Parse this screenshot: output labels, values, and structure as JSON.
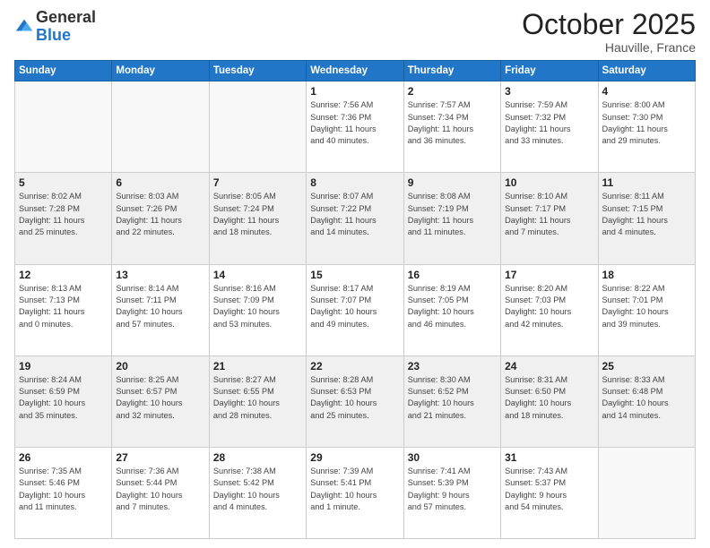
{
  "header": {
    "logo_general": "General",
    "logo_blue": "Blue",
    "month": "October 2025",
    "location": "Hauville, France"
  },
  "days_of_week": [
    "Sunday",
    "Monday",
    "Tuesday",
    "Wednesday",
    "Thursday",
    "Friday",
    "Saturday"
  ],
  "weeks": [
    {
      "shaded": false,
      "days": [
        {
          "num": "",
          "info": ""
        },
        {
          "num": "",
          "info": ""
        },
        {
          "num": "",
          "info": ""
        },
        {
          "num": "1",
          "info": "Sunrise: 7:56 AM\nSunset: 7:36 PM\nDaylight: 11 hours\nand 40 minutes."
        },
        {
          "num": "2",
          "info": "Sunrise: 7:57 AM\nSunset: 7:34 PM\nDaylight: 11 hours\nand 36 minutes."
        },
        {
          "num": "3",
          "info": "Sunrise: 7:59 AM\nSunset: 7:32 PM\nDaylight: 11 hours\nand 33 minutes."
        },
        {
          "num": "4",
          "info": "Sunrise: 8:00 AM\nSunset: 7:30 PM\nDaylight: 11 hours\nand 29 minutes."
        }
      ]
    },
    {
      "shaded": true,
      "days": [
        {
          "num": "5",
          "info": "Sunrise: 8:02 AM\nSunset: 7:28 PM\nDaylight: 11 hours\nand 25 minutes."
        },
        {
          "num": "6",
          "info": "Sunrise: 8:03 AM\nSunset: 7:26 PM\nDaylight: 11 hours\nand 22 minutes."
        },
        {
          "num": "7",
          "info": "Sunrise: 8:05 AM\nSunset: 7:24 PM\nDaylight: 11 hours\nand 18 minutes."
        },
        {
          "num": "8",
          "info": "Sunrise: 8:07 AM\nSunset: 7:22 PM\nDaylight: 11 hours\nand 14 minutes."
        },
        {
          "num": "9",
          "info": "Sunrise: 8:08 AM\nSunset: 7:19 PM\nDaylight: 11 hours\nand 11 minutes."
        },
        {
          "num": "10",
          "info": "Sunrise: 8:10 AM\nSunset: 7:17 PM\nDaylight: 11 hours\nand 7 minutes."
        },
        {
          "num": "11",
          "info": "Sunrise: 8:11 AM\nSunset: 7:15 PM\nDaylight: 11 hours\nand 4 minutes."
        }
      ]
    },
    {
      "shaded": false,
      "days": [
        {
          "num": "12",
          "info": "Sunrise: 8:13 AM\nSunset: 7:13 PM\nDaylight: 11 hours\nand 0 minutes."
        },
        {
          "num": "13",
          "info": "Sunrise: 8:14 AM\nSunset: 7:11 PM\nDaylight: 10 hours\nand 57 minutes."
        },
        {
          "num": "14",
          "info": "Sunrise: 8:16 AM\nSunset: 7:09 PM\nDaylight: 10 hours\nand 53 minutes."
        },
        {
          "num": "15",
          "info": "Sunrise: 8:17 AM\nSunset: 7:07 PM\nDaylight: 10 hours\nand 49 minutes."
        },
        {
          "num": "16",
          "info": "Sunrise: 8:19 AM\nSunset: 7:05 PM\nDaylight: 10 hours\nand 46 minutes."
        },
        {
          "num": "17",
          "info": "Sunrise: 8:20 AM\nSunset: 7:03 PM\nDaylight: 10 hours\nand 42 minutes."
        },
        {
          "num": "18",
          "info": "Sunrise: 8:22 AM\nSunset: 7:01 PM\nDaylight: 10 hours\nand 39 minutes."
        }
      ]
    },
    {
      "shaded": true,
      "days": [
        {
          "num": "19",
          "info": "Sunrise: 8:24 AM\nSunset: 6:59 PM\nDaylight: 10 hours\nand 35 minutes."
        },
        {
          "num": "20",
          "info": "Sunrise: 8:25 AM\nSunset: 6:57 PM\nDaylight: 10 hours\nand 32 minutes."
        },
        {
          "num": "21",
          "info": "Sunrise: 8:27 AM\nSunset: 6:55 PM\nDaylight: 10 hours\nand 28 minutes."
        },
        {
          "num": "22",
          "info": "Sunrise: 8:28 AM\nSunset: 6:53 PM\nDaylight: 10 hours\nand 25 minutes."
        },
        {
          "num": "23",
          "info": "Sunrise: 8:30 AM\nSunset: 6:52 PM\nDaylight: 10 hours\nand 21 minutes."
        },
        {
          "num": "24",
          "info": "Sunrise: 8:31 AM\nSunset: 6:50 PM\nDaylight: 10 hours\nand 18 minutes."
        },
        {
          "num": "25",
          "info": "Sunrise: 8:33 AM\nSunset: 6:48 PM\nDaylight: 10 hours\nand 14 minutes."
        }
      ]
    },
    {
      "shaded": false,
      "days": [
        {
          "num": "26",
          "info": "Sunrise: 7:35 AM\nSunset: 5:46 PM\nDaylight: 10 hours\nand 11 minutes."
        },
        {
          "num": "27",
          "info": "Sunrise: 7:36 AM\nSunset: 5:44 PM\nDaylight: 10 hours\nand 7 minutes."
        },
        {
          "num": "28",
          "info": "Sunrise: 7:38 AM\nSunset: 5:42 PM\nDaylight: 10 hours\nand 4 minutes."
        },
        {
          "num": "29",
          "info": "Sunrise: 7:39 AM\nSunset: 5:41 PM\nDaylight: 10 hours\nand 1 minute."
        },
        {
          "num": "30",
          "info": "Sunrise: 7:41 AM\nSunset: 5:39 PM\nDaylight: 9 hours\nand 57 minutes."
        },
        {
          "num": "31",
          "info": "Sunrise: 7:43 AM\nSunset: 5:37 PM\nDaylight: 9 hours\nand 54 minutes."
        },
        {
          "num": "",
          "info": ""
        }
      ]
    }
  ]
}
